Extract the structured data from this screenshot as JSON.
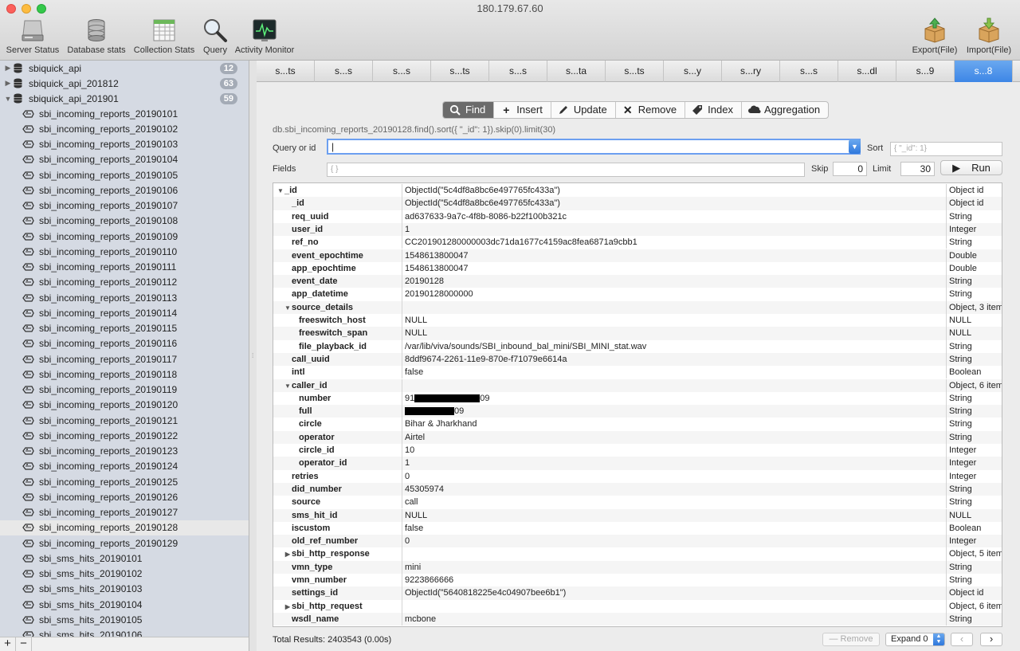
{
  "window": {
    "title": "180.179.67.60"
  },
  "toolbar": {
    "server_status": "Server Status",
    "database_stats": "Database stats",
    "collection_stats": "Collection Stats",
    "query": "Query",
    "activity_monitor": "Activity Monitor",
    "export": "Export(File)",
    "import": "Import(File)"
  },
  "sidebar": {
    "databases": [
      {
        "name": "sbiquick_api",
        "count": "12",
        "expanded": false
      },
      {
        "name": "sbiquick_api_201812",
        "count": "63",
        "expanded": false
      },
      {
        "name": "sbiquick_api_201901",
        "count": "59",
        "expanded": true
      }
    ],
    "collections": [
      "sbi_incoming_reports_20190101",
      "sbi_incoming_reports_20190102",
      "sbi_incoming_reports_20190103",
      "sbi_incoming_reports_20190104",
      "sbi_incoming_reports_20190105",
      "sbi_incoming_reports_20190106",
      "sbi_incoming_reports_20190107",
      "sbi_incoming_reports_20190108",
      "sbi_incoming_reports_20190109",
      "sbi_incoming_reports_20190110",
      "sbi_incoming_reports_20190111",
      "sbi_incoming_reports_20190112",
      "sbi_incoming_reports_20190113",
      "sbi_incoming_reports_20190114",
      "sbi_incoming_reports_20190115",
      "sbi_incoming_reports_20190116",
      "sbi_incoming_reports_20190117",
      "sbi_incoming_reports_20190118",
      "sbi_incoming_reports_20190119",
      "sbi_incoming_reports_20190120",
      "sbi_incoming_reports_20190121",
      "sbi_incoming_reports_20190122",
      "sbi_incoming_reports_20190123",
      "sbi_incoming_reports_20190124",
      "sbi_incoming_reports_20190125",
      "sbi_incoming_reports_20190126",
      "sbi_incoming_reports_20190127",
      "sbi_incoming_reports_20190128",
      "sbi_incoming_reports_20190129",
      "sbi_sms_hits_20190101",
      "sbi_sms_hits_20190102",
      "sbi_sms_hits_20190103",
      "sbi_sms_hits_20190104",
      "sbi_sms_hits_20190105",
      "sbi_sms_hits_20190106"
    ],
    "selected_collection": "sbi_incoming_reports_20190128",
    "add": "+",
    "remove": "−"
  },
  "tabs": [
    "s...ts",
    "s...s",
    "s...s",
    "s...ts",
    "s...s",
    "s...ta",
    "s...ts",
    "s...y",
    "s...ry",
    "s...s",
    "s...dl",
    "s...9",
    "s...8"
  ],
  "active_tab": 12,
  "operations": {
    "find": "Find",
    "insert": "Insert",
    "update": "Update",
    "remove": "Remove",
    "index": "Index",
    "aggregation": "Aggregation"
  },
  "query": {
    "preview": "db.sbi_incoming_reports_20190128.find().sort({ \"_id\": 1}).skip(0).limit(30)",
    "query_label": "Query or id",
    "query_value": "|",
    "sort_label": "Sort",
    "sort_placeholder": "{ \"_id\": 1}",
    "fields_label": "Fields",
    "fields_placeholder": "{ }",
    "skip_label": "Skip",
    "skip_value": "0",
    "limit_label": "Limit",
    "limit_value": "30",
    "run": "Run"
  },
  "results": {
    "rows": [
      {
        "key": "_id",
        "value": "ObjectId(\"5c4df8a8bc6e497765fc433a\")",
        "type": "Object id",
        "indent": 0,
        "toggle": "open"
      },
      {
        "key": "_id",
        "value": "ObjectId(\"5c4df8a8bc6e497765fc433a\")",
        "type": "Object id",
        "indent": 1,
        "toggle": "none"
      },
      {
        "key": "req_uuid",
        "value": "ad637633-9a7c-4f8b-8086-b22f100b321c",
        "type": "String",
        "indent": 1,
        "toggle": "none"
      },
      {
        "key": "user_id",
        "value": "1",
        "type": "Integer",
        "indent": 1,
        "toggle": "none"
      },
      {
        "key": "ref_no",
        "value": "CC201901280000003dc71da1677c4159ac8fea6871a9cbb1",
        "type": "String",
        "indent": 1,
        "toggle": "none"
      },
      {
        "key": "event_epochtime",
        "value": "1548613800047",
        "type": "Double",
        "indent": 1,
        "toggle": "none"
      },
      {
        "key": "app_epochtime",
        "value": "1548613800047",
        "type": "Double",
        "indent": 1,
        "toggle": "none"
      },
      {
        "key": "event_date",
        "value": "20190128",
        "type": "String",
        "indent": 1,
        "toggle": "none"
      },
      {
        "key": "app_datetime",
        "value": "20190128000000",
        "type": "String",
        "indent": 1,
        "toggle": "none"
      },
      {
        "key": "source_details",
        "value": "",
        "type": "Object, 3 items",
        "indent": 1,
        "toggle": "open"
      },
      {
        "key": "freeswitch_host",
        "value": "NULL",
        "type": "NULL",
        "indent": 2,
        "toggle": "none"
      },
      {
        "key": "freeswitch_span",
        "value": "NULL",
        "type": "NULL",
        "indent": 2,
        "toggle": "none"
      },
      {
        "key": "file_playback_id",
        "value": "/var/lib/viva/sounds/SBI_inbound_bal_mini/SBI_MINI_stat.wav",
        "type": "String",
        "indent": 2,
        "toggle": "none"
      },
      {
        "key": "call_uuid",
        "value": "8ddf9674-2261-11e9-870e-f71079e6614a",
        "type": "String",
        "indent": 1,
        "toggle": "none"
      },
      {
        "key": "intl",
        "value": "false",
        "type": "Boolean",
        "indent": 1,
        "toggle": "none"
      },
      {
        "key": "caller_id",
        "value": "",
        "type": "Object, 6 items",
        "indent": 1,
        "toggle": "open"
      },
      {
        "key": "number",
        "value": "91",
        "value_suffix": "09",
        "redact": 1,
        "type": "String",
        "indent": 2,
        "toggle": "none"
      },
      {
        "key": "full",
        "value": "",
        "value_suffix": "09",
        "redact": 2,
        "type": "String",
        "indent": 2,
        "toggle": "none"
      },
      {
        "key": "circle",
        "value": "Bihar & Jharkhand",
        "type": "String",
        "indent": 2,
        "toggle": "none"
      },
      {
        "key": "operator",
        "value": "Airtel",
        "type": "String",
        "indent": 2,
        "toggle": "none"
      },
      {
        "key": "circle_id",
        "value": "10",
        "type": "Integer",
        "indent": 2,
        "toggle": "none"
      },
      {
        "key": "operator_id",
        "value": "1",
        "type": "Integer",
        "indent": 2,
        "toggle": "none"
      },
      {
        "key": "retries",
        "value": "0",
        "type": "Integer",
        "indent": 1,
        "toggle": "none"
      },
      {
        "key": "did_number",
        "value": "45305974",
        "type": "String",
        "indent": 1,
        "toggle": "none"
      },
      {
        "key": "source",
        "value": "call",
        "type": "String",
        "indent": 1,
        "toggle": "none"
      },
      {
        "key": "sms_hit_id",
        "value": "NULL",
        "type": "NULL",
        "indent": 1,
        "toggle": "none"
      },
      {
        "key": "iscustom",
        "value": "false",
        "type": "Boolean",
        "indent": 1,
        "toggle": "none"
      },
      {
        "key": "old_ref_number",
        "value": "0",
        "type": "Integer",
        "indent": 1,
        "toggle": "none"
      },
      {
        "key": "sbi_http_response",
        "value": "",
        "type": "Object, 5 items",
        "indent": 1,
        "toggle": "closed"
      },
      {
        "key": "vmn_type",
        "value": "mini",
        "type": "String",
        "indent": 1,
        "toggle": "none"
      },
      {
        "key": "vmn_number",
        "value": "9223866666",
        "type": "String",
        "indent": 1,
        "toggle": "none"
      },
      {
        "key": "settings_id",
        "value": "ObjectId(\"5640818225e4c04907bee6b1\")",
        "type": "Object id",
        "indent": 1,
        "toggle": "none"
      },
      {
        "key": "sbi_http_request",
        "value": "",
        "type": "Object, 6 items",
        "indent": 1,
        "toggle": "closed"
      },
      {
        "key": "wsdl_name",
        "value": "mcbone",
        "type": "String",
        "indent": 1,
        "toggle": "none"
      }
    ]
  },
  "footer": {
    "total": "Total Results: 2403543 (0.00s)",
    "remove": "— Remove",
    "expand": "Expand 0",
    "prev": "‹",
    "next": "›"
  },
  "colors": {
    "accent": "#3d86e6",
    "sidebar_bg": "#d5dae3",
    "active_op": "#6b6b6b"
  }
}
